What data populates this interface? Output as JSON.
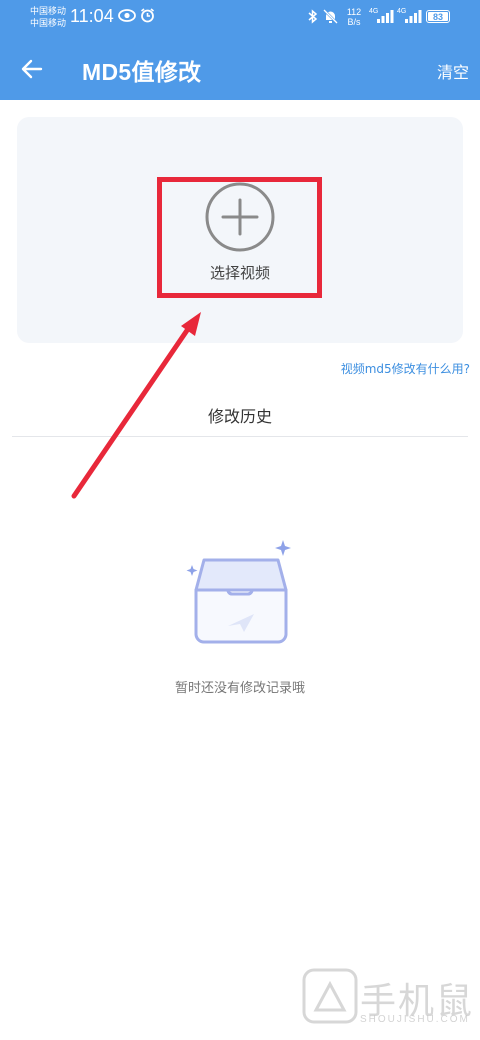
{
  "statusbar": {
    "carrier_1": "中国移动",
    "carrier_2": "中国移动",
    "time": "11:04",
    "net_speed_value": "112",
    "net_speed_unit": "B/s",
    "signal_1_label": "4G",
    "signal_2_label": "4G",
    "battery_level": "83",
    "icons": [
      "eye-icon",
      "alarm-icon",
      "bluetooth-icon",
      "mute-icon",
      "wifi-icon",
      "signal-icon",
      "battery-icon"
    ]
  },
  "header": {
    "title": "MD5值修改",
    "clear_label": "清空",
    "background_color": "#4f9ae8"
  },
  "upload": {
    "select_label": "选择视频",
    "help_link": "视频md5修改有什么用?"
  },
  "history": {
    "title": "修改历史",
    "empty_text": "暂时还没有修改记录哦"
  },
  "annotation": {
    "highlight_color": "#e8283a"
  },
  "watermark": {
    "text": "手机鼠",
    "sub": "SHOUJISHU.COM"
  }
}
